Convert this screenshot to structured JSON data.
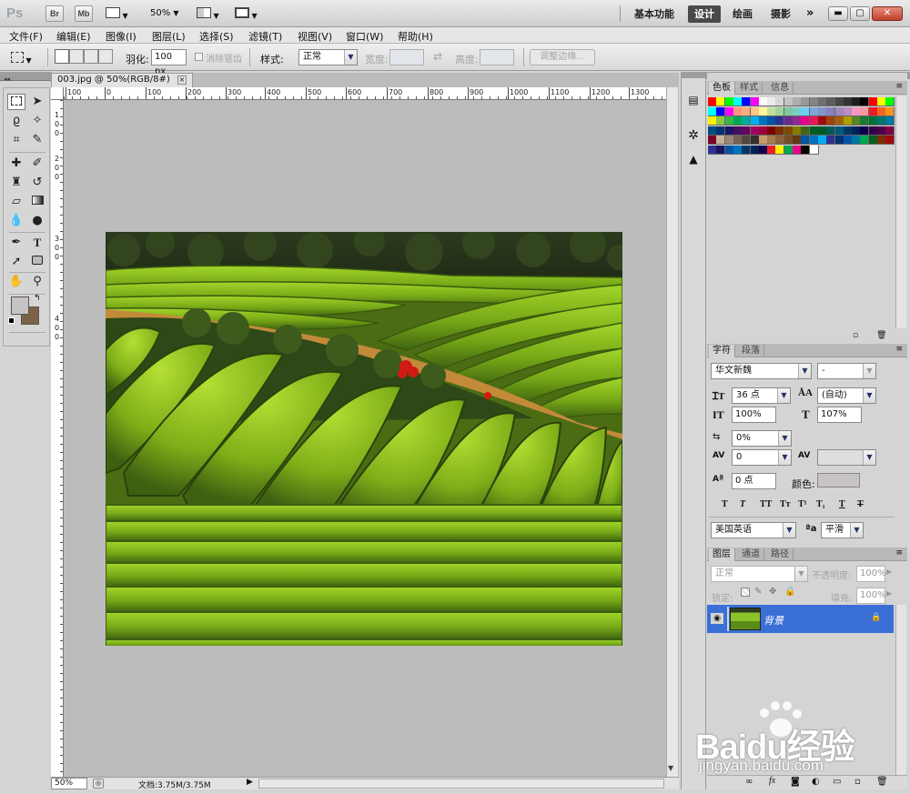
{
  "app": {
    "logo": "Ps",
    "mini_buttons": [
      "Br",
      "Mb"
    ],
    "zoom": "50%",
    "workspaces": [
      {
        "label": "基本功能",
        "active": false
      },
      {
        "label": "设计",
        "active": true
      },
      {
        "label": "绘画",
        "active": false
      },
      {
        "label": "摄影",
        "active": false
      }
    ],
    "more": "»"
  },
  "menu": [
    "文件(F)",
    "编辑(E)",
    "图像(I)",
    "图层(L)",
    "选择(S)",
    "滤镜(T)",
    "视图(V)",
    "窗口(W)",
    "帮助(H)"
  ],
  "options": {
    "feather_label": "羽化:",
    "feather_value": "100 px",
    "antialias_label": "消除锯齿",
    "style_label": "样式:",
    "style_value": "正常",
    "width_label": "宽度:",
    "height_label": "高度:",
    "refine_label": "调整边缘..."
  },
  "document": {
    "tab_title": "003.jpg @ 50%(RGB/8#)",
    "close": "×",
    "h_ruler": [
      "100",
      "0",
      "100",
      "200",
      "300",
      "400",
      "500",
      "600",
      "700",
      "800",
      "900",
      "1000",
      "1100",
      "1200",
      "1300"
    ],
    "v_ruler": [
      "1",
      "0",
      "0",
      "2",
      "0",
      "0",
      "3",
      "0",
      "0",
      "4",
      "0",
      "0"
    ],
    "status_zoom": "50%",
    "status_doc": "文档:3.75M/3.75M"
  },
  "swatches_panel": {
    "tabs": [
      "色板",
      "样式",
      "信息"
    ]
  },
  "character": {
    "tabs": [
      "字符",
      "段落"
    ],
    "font_family": "华文新魏",
    "font_style": "-",
    "size": "36 点",
    "leading": "(自动)",
    "vscale": "100%",
    "hscale": "107%",
    "tsume": "0%",
    "kerning": "0",
    "baseline": "0 点",
    "color_label": "颜色:",
    "style_buttons": [
      "T",
      "T",
      "TT",
      "Tт",
      "T¹",
      "T₁",
      "T",
      "T"
    ],
    "language": "美国英语",
    "aa_label": "ªa",
    "antialias": "平滑"
  },
  "layers": {
    "tabs": [
      "图层",
      "通道",
      "路径"
    ],
    "blend": "正常",
    "opacity_label": "不透明度:",
    "opacity": "100%",
    "lock_label": "锁定:",
    "fill_label": "填充:",
    "fill": "100%",
    "layer_name": "背景"
  },
  "watermark": {
    "brand": "Baidu经验",
    "url": "jingyan.baidu.com"
  },
  "colors": {
    "accent": "#3a6fd6",
    "photo_green": "#7fb51a"
  }
}
